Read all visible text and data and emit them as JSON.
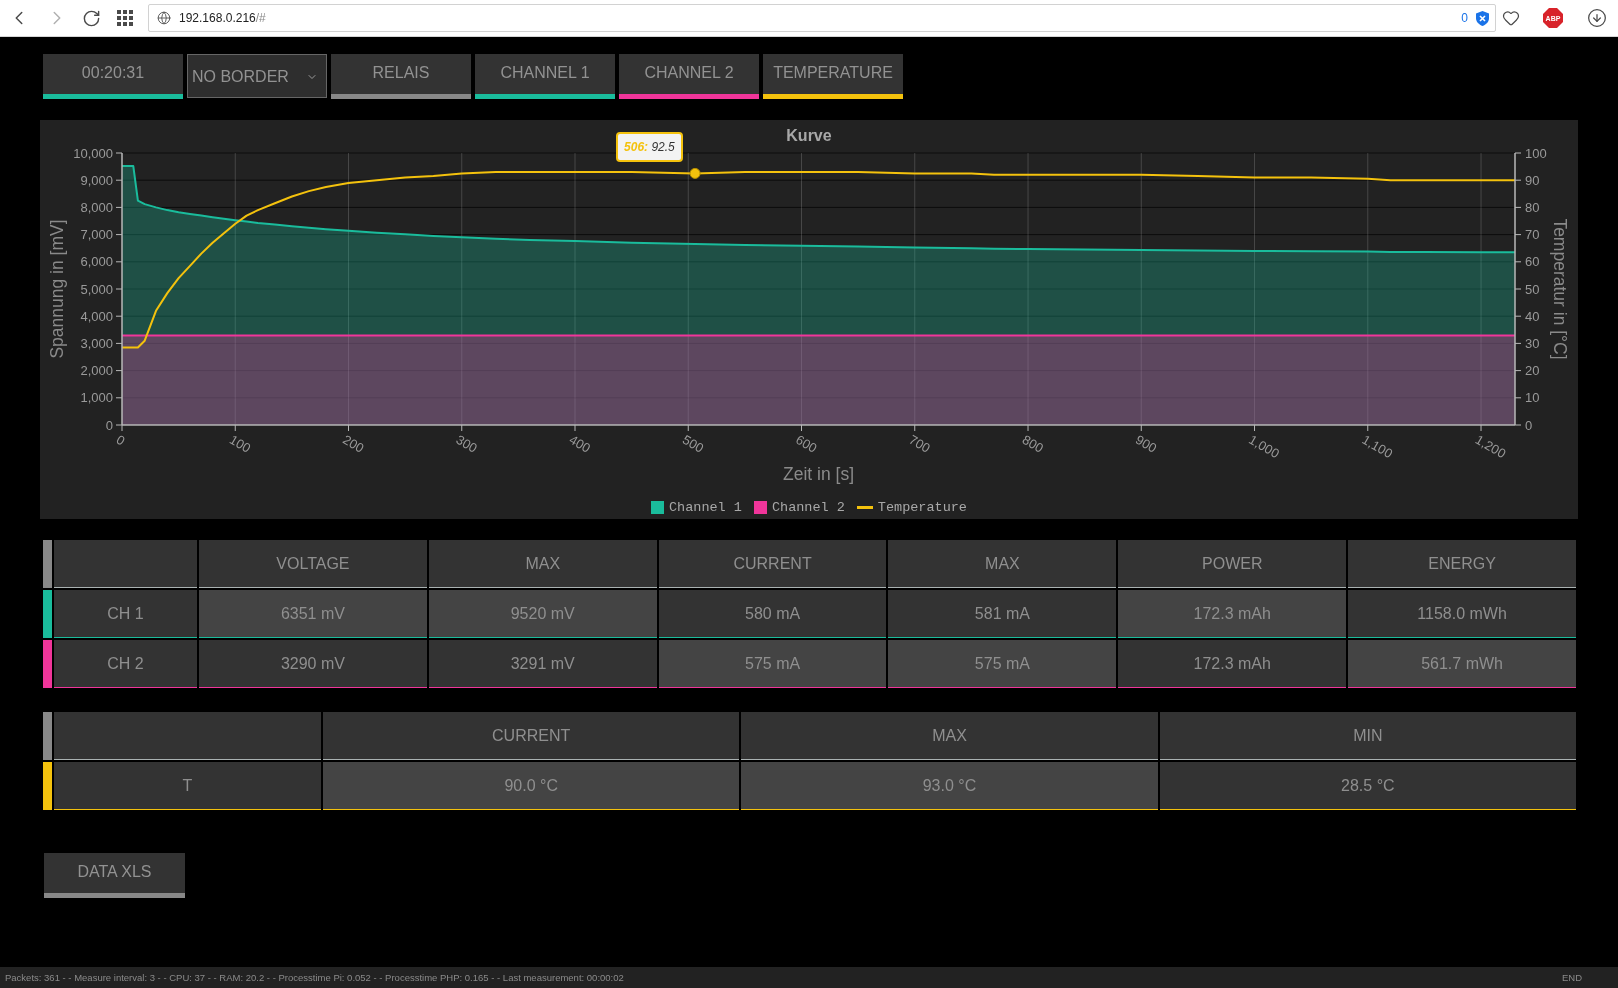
{
  "browser": {
    "forward_disabled": true,
    "url_host": "192.168.0.216",
    "url_path": "/#",
    "blocked_count": "0",
    "adblock_label": "ABP"
  },
  "toolbar": {
    "items": [
      {
        "kind": "timer",
        "label": "00:20:31",
        "color": "#1abc9c"
      },
      {
        "kind": "select",
        "label": "NO BORDER"
      },
      {
        "kind": "button",
        "label": "RELAIS",
        "color": "#888888"
      },
      {
        "kind": "button",
        "label": "CHANNEL 1",
        "color": "#1abc9c"
      },
      {
        "kind": "button",
        "label": "CHANNEL 2",
        "color": "#f0359a"
      },
      {
        "kind": "button",
        "label": "TEMPERATURE",
        "color": "#f4c20d"
      }
    ]
  },
  "chart": {
    "chart_data": {
      "type": "area",
      "title": "Kurve",
      "xlabel": "Zeit in [s]",
      "ylabel": "Spannung in [mV]",
      "y2label": "Temperatur in [°C]",
      "x": [
        0,
        10,
        14,
        20,
        30,
        40,
        50,
        60,
        70,
        80,
        90,
        100,
        110,
        120,
        135,
        150,
        165,
        180,
        200,
        225,
        250,
        275,
        300,
        330,
        360,
        400,
        450,
        506,
        550,
        600,
        650,
        700,
        750,
        770,
        800,
        850,
        900,
        950,
        1000,
        1050,
        1100,
        1120,
        1150,
        1200,
        1230
      ],
      "series": [
        {
          "name": "Channel 1",
          "color": "#1abc9c",
          "values": [
            9520,
            9520,
            8250,
            8120,
            8000,
            7900,
            7820,
            7760,
            7700,
            7640,
            7580,
            7530,
            7480,
            7430,
            7370,
            7310,
            7250,
            7200,
            7140,
            7070,
            7010,
            6950,
            6900,
            6850,
            6800,
            6760,
            6700,
            6650,
            6620,
            6590,
            6560,
            6530,
            6500,
            6480,
            6470,
            6450,
            6430,
            6420,
            6400,
            6390,
            6380,
            6360,
            6360,
            6350,
            6350
          ]
        },
        {
          "name": "Channel 2",
          "color": "#f0359a",
          "values": [
            3290,
            3290,
            3290,
            3290,
            3290,
            3290,
            3290,
            3290,
            3290,
            3290,
            3290,
            3290,
            3290,
            3290,
            3290,
            3290,
            3290,
            3290,
            3290,
            3290,
            3290,
            3290,
            3290,
            3290,
            3290,
            3290,
            3290,
            3290,
            3290,
            3290,
            3290,
            3290,
            3290,
            3290,
            3290,
            3290,
            3290,
            3290,
            3290,
            3290,
            3290,
            3290,
            3290,
            3290,
            3290
          ]
        },
        {
          "name": "Temperature",
          "color": "#f4c20d",
          "type": "line",
          "axis": "y2",
          "values": [
            28.5,
            28.5,
            28.5,
            31,
            42,
            48.5,
            54,
            58.5,
            63,
            67,
            70.5,
            74,
            77,
            79,
            81.5,
            84,
            86,
            87.5,
            89,
            90,
            91,
            91.5,
            92.5,
            93,
            93,
            93,
            93,
            92.5,
            93,
            93,
            93,
            92.5,
            92.5,
            92,
            92,
            92,
            92,
            91.5,
            91,
            91,
            90.5,
            90,
            90,
            90,
            90
          ]
        }
      ],
      "xlim": [
        0,
        1230
      ],
      "ylim": [
        0,
        10000
      ],
      "y2lim": [
        0,
        100
      ],
      "xticks": [
        {
          "value": 0,
          "label": "0"
        },
        100,
        200,
        300,
        400,
        500,
        600,
        700,
        800,
        900,
        {
          "value": 1000,
          "label": "1,000"
        },
        {
          "value": 1100,
          "label": "1,100"
        },
        {
          "value": 1200,
          "label": "1,200"
        }
      ],
      "yticks": [
        {
          "value": 0,
          "label": "0"
        },
        {
          "value": 1000,
          "label": "1,000"
        },
        {
          "value": 2000,
          "label": "2,000"
        },
        {
          "value": 3000,
          "label": "3,000"
        },
        {
          "value": 4000,
          "label": "4,000"
        },
        {
          "value": 5000,
          "label": "5,000"
        },
        {
          "value": 6000,
          "label": "6,000"
        },
        {
          "value": 7000,
          "label": "7,000"
        },
        {
          "value": 8000,
          "label": "8,000"
        },
        {
          "value": 9000,
          "label": "9,000"
        },
        {
          "value": 10000,
          "label": "10,000"
        }
      ],
      "y2ticks": [
        {
          "value": 0,
          "label": "0"
        },
        10,
        20,
        30,
        40,
        50,
        60,
        70,
        80,
        90,
        100
      ],
      "grid": true,
      "legend": "bottom",
      "annotations": [
        {
          "x": 506,
          "y": 9250,
          "text": "**506:** 92.5"
        }
      ]
    }
  },
  "channel_table": {
    "columns": [
      "VOLTAGE",
      "MAX",
      "CURRENT",
      "MAX",
      "POWER",
      "ENERGY"
    ],
    "rows": [
      {
        "label": "CH 1",
        "color": "#1abc9c",
        "cells": [
          {
            "text": "6351 mV",
            "highlighted": true
          },
          {
            "text": "9520 mV",
            "highlighted": true
          },
          {
            "text": "580 mA",
            "highlighted": false
          },
          {
            "text": "581 mA",
            "highlighted": false
          },
          {
            "text": "172.3 mAh",
            "highlighted": true
          },
          {
            "text": "1158.0 mWh",
            "highlighted": false
          }
        ]
      },
      {
        "label": "CH 2",
        "color": "#f0359a",
        "cells": [
          {
            "text": "3290 mV",
            "highlighted": false
          },
          {
            "text": "3291 mV",
            "highlighted": false
          },
          {
            "text": "575 mA",
            "highlighted": true
          },
          {
            "text": "575 mA",
            "highlighted": true
          },
          {
            "text": "172.3 mAh",
            "highlighted": false
          },
          {
            "text": "561.7 mWh",
            "highlighted": true
          }
        ]
      }
    ]
  },
  "temperature_table": {
    "columns": [
      "CURRENT",
      "MAX",
      "MIN"
    ],
    "rows": [
      {
        "label": "T",
        "color": "#f4c20d",
        "cells": [
          {
            "text": "90.0 °C",
            "highlighted": true
          },
          {
            "text": "93.0 °C",
            "highlighted": true
          },
          {
            "text": "28.5 °C",
            "highlighted": false
          }
        ]
      }
    ]
  },
  "export_button": {
    "label": "DATA XLS"
  },
  "status_bar": {
    "text": "Packets: 361 - - Measure interval: 3 - - CPU: 37 - - RAM: 20.2 - - Processtime Pi: 0.052 - - Processtime PHP: 0.165 - - Last measurement: 00:00:02",
    "end_label": "END"
  }
}
